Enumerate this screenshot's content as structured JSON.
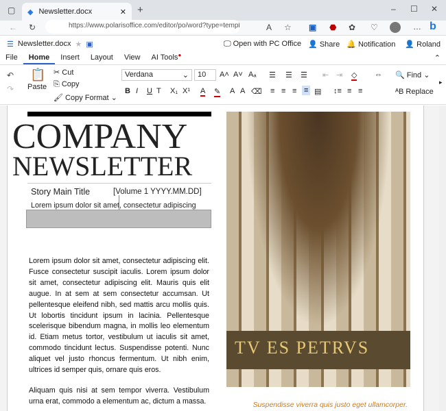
{
  "browser": {
    "tab_title": "Newsletter.docx",
    "url": "https://www.polarisoffice.com/editor/po/word?type=template&te..."
  },
  "app": {
    "file_name": "Newsletter.docx",
    "open_pc": "Open with PC Office",
    "share": "Share",
    "notification": "Notification",
    "user": "Roland"
  },
  "menu": [
    "File",
    "Home",
    "Insert",
    "Layout",
    "View",
    "AI Tools"
  ],
  "toolbar": {
    "paste": "Paste",
    "cut": "Cut",
    "copy": "Copy",
    "copy_format": "Copy Format",
    "font": "Verdana",
    "size": "10",
    "find": "Find",
    "replace": "Replace"
  },
  "doc": {
    "title1": "COMPANY",
    "title2": "NEWSLETTER",
    "story_title": "Story Main Title",
    "volume": "[Volume 1 YYYY.MM.DD]",
    "subtitle": "Lorem ipsum dolor sit amet, consectetur adipiscing",
    "para1": "Lorem ipsum dolor sit amet, consectetur adipiscing elit. Fusce consectetur suscipit iaculis. Lorem ipsum dolor sit amet, consectetur adipiscing elit. Mauris quis elit augue. In at sem at sem consectetur accumsan. Ut pellentesque eleifend nibh, sed mattis arcu mollis quis. Ut lobortis tincidunt ipsum in lacinia. Pellentesque scelerisque bibendum magna, in mollis leo elementum id. Etiam metus tortor, vestibulum ut iaculis sit amet, commodo tincidunt lectus. Suspendisse potenti. Nunc aliquet vel justo rhoncus fermentum. Ut nibh enim, ultrices id semper quis, ornare quis eros.",
    "para2": "Aliquam quis nisi at sem tempor viverra. Vestibulum urna erat, commodo a elementum ac, dictum a massa.",
    "photo_inscription": "TV ES PETRVS",
    "caption": "Suspendisse viverra quis justo eget ullamcorper."
  }
}
